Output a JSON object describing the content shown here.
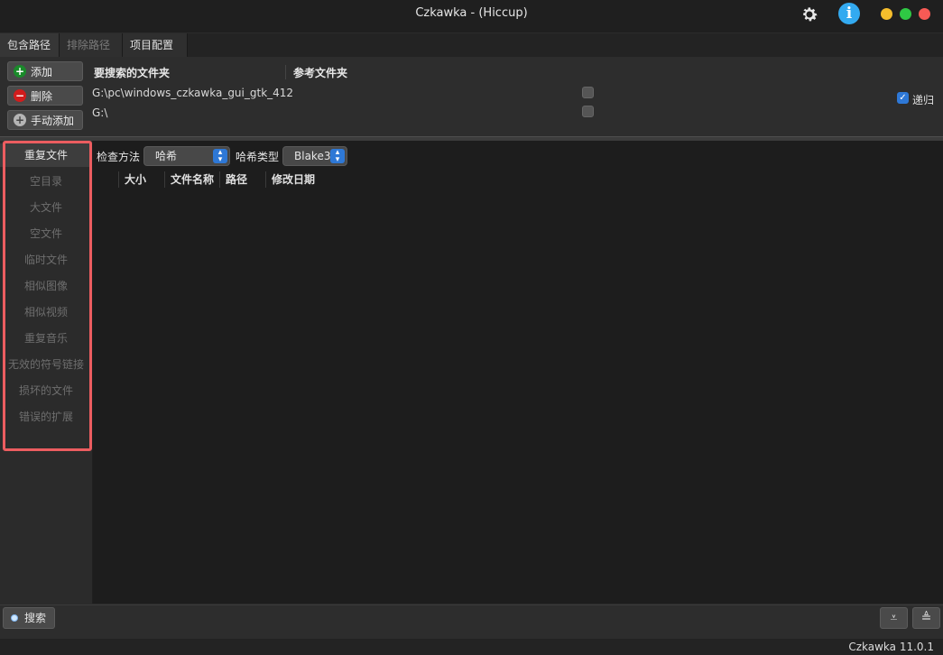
{
  "window": {
    "title": "Czkawka - (Hiccup)"
  },
  "tabs": [
    {
      "label": "包含路径"
    },
    {
      "label": "排除路径"
    },
    {
      "label": "项目配置"
    }
  ],
  "paths": {
    "add_label": "添加",
    "remove_label": "删除",
    "manual_add_label": "手动添加",
    "col_folders": "要搜索的文件夹",
    "col_reference": "参考文件夹",
    "rows": [
      {
        "path": "G:\\pc\\windows_czkawka_gui_gtk_412"
      },
      {
        "path": "G:\\"
      }
    ],
    "recursive_label": "递归"
  },
  "sidebar": {
    "items": [
      {
        "label": "重复文件"
      },
      {
        "label": "空目录"
      },
      {
        "label": "大文件"
      },
      {
        "label": "空文件"
      },
      {
        "label": "临时文件"
      },
      {
        "label": "相似图像"
      },
      {
        "label": "相似视频"
      },
      {
        "label": "重复音乐"
      },
      {
        "label": "无效的符号链接"
      },
      {
        "label": "损坏的文件"
      },
      {
        "label": "错误的扩展"
      }
    ]
  },
  "options": {
    "method_label": "检查方法",
    "method_value": "哈希",
    "hash_type_label": "哈希类型",
    "hash_type_value": "Blake3"
  },
  "table": {
    "columns": [
      "大小",
      "文件名称",
      "路径",
      "修改日期"
    ]
  },
  "bottom": {
    "search_label": "搜索",
    "version": "Czkawka 11.0.1"
  }
}
